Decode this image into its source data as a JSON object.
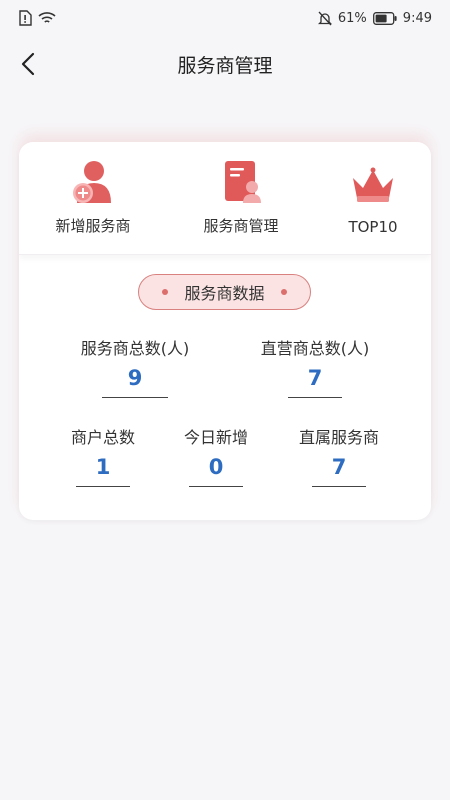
{
  "status": {
    "battery": "61%",
    "time": "9:49"
  },
  "header": {
    "title": "服务商管理"
  },
  "menu": [
    {
      "label": "新增服务商",
      "icon": "add-person-icon"
    },
    {
      "label": "服务商管理",
      "icon": "person-document-icon"
    },
    {
      "label": "TOP10",
      "icon": "crown-icon"
    }
  ],
  "data_section": {
    "title": "服务商数据",
    "stats": {
      "total_providers": {
        "label": "服务商总数(人)",
        "value": "9"
      },
      "direct_providers": {
        "label": "直营商总数(人)",
        "value": "7"
      },
      "merchants": {
        "label": "商户总数",
        "value": "1"
      },
      "today_new": {
        "label": "今日新增",
        "value": "0"
      },
      "affiliated": {
        "label": "直属服务商",
        "value": "7"
      }
    }
  },
  "colors": {
    "accent": "#e05a5a",
    "value_blue": "#2d6cc0",
    "pill_bg": "#fbe3e3"
  }
}
